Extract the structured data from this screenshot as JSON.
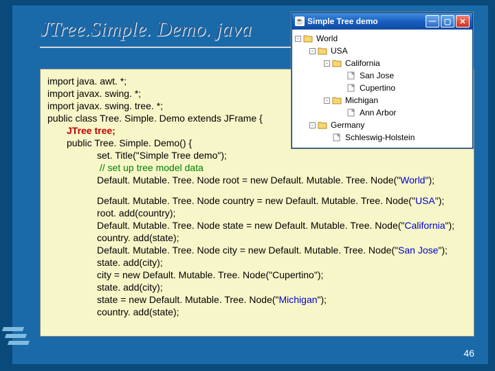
{
  "title": "JTree.Simple. Demo. java",
  "page_number": "46",
  "window": {
    "title": "Simple Tree demo",
    "tree": {
      "root": "World",
      "nodes": [
        {
          "level": 0,
          "toggle": "-",
          "kind": "folder",
          "label": "World"
        },
        {
          "level": 1,
          "toggle": "-",
          "kind": "folder",
          "label": "USA"
        },
        {
          "level": 2,
          "toggle": "-",
          "kind": "folder",
          "label": "California"
        },
        {
          "level": 3,
          "toggle": "",
          "kind": "leaf",
          "label": "San Jose"
        },
        {
          "level": 3,
          "toggle": "",
          "kind": "leaf",
          "label": "Cupertino"
        },
        {
          "level": 2,
          "toggle": "-",
          "kind": "folder",
          "label": "Michigan"
        },
        {
          "level": 3,
          "toggle": "",
          "kind": "leaf",
          "label": "Ann Arbor"
        },
        {
          "level": 1,
          "toggle": "-",
          "kind": "folder",
          "label": "Germany"
        },
        {
          "level": 2,
          "toggle": "",
          "kind": "leaf",
          "label": "Schleswig-Holstein"
        }
      ]
    }
  },
  "code": {
    "l1": "import java. awt. *;",
    "l2": "import javax. swing. *;",
    "l3": "import javax. swing. tree. *;",
    "l4": "public class Tree. Simple. Demo extends JFrame {",
    "l5": "JTree tree;",
    "l6": "public Tree. Simple. Demo() {",
    "l7": "set. Title(\"Simple Tree demo\");",
    "l8": " // set up tree model data",
    "l9a": "Default. Mutable. Tree. Node root = new Default. Mutable. Tree. Node(\"",
    "l9b": "World",
    "l9c": "\");",
    "l10a": "Default. Mutable. Tree. Node country = new Default. Mutable. Tree. Node(\"",
    "l10b": "USA",
    "l10c": "\");",
    "l11": "root. add(country);",
    "l12a": "Default. Mutable. Tree. Node state = new Default. Mutable. Tree. Node(\"",
    "l12b": "California",
    "l12c": "\");",
    "l13": "country. add(state);",
    "l14a": "Default. Mutable. Tree. Node city = new Default. Mutable. Tree. Node(\"",
    "l14b": "San Jose",
    "l14c": "\");",
    "l15": "state. add(city);",
    "l16": "city = new Default. Mutable. Tree. Node(\"Cupertino\");",
    "l17": "state. add(city);",
    "l18a": "state = new Default. Mutable. Tree. Node(\"",
    "l18b": "Michigan",
    "l18c": "\");",
    "l19": "country. add(state);"
  }
}
